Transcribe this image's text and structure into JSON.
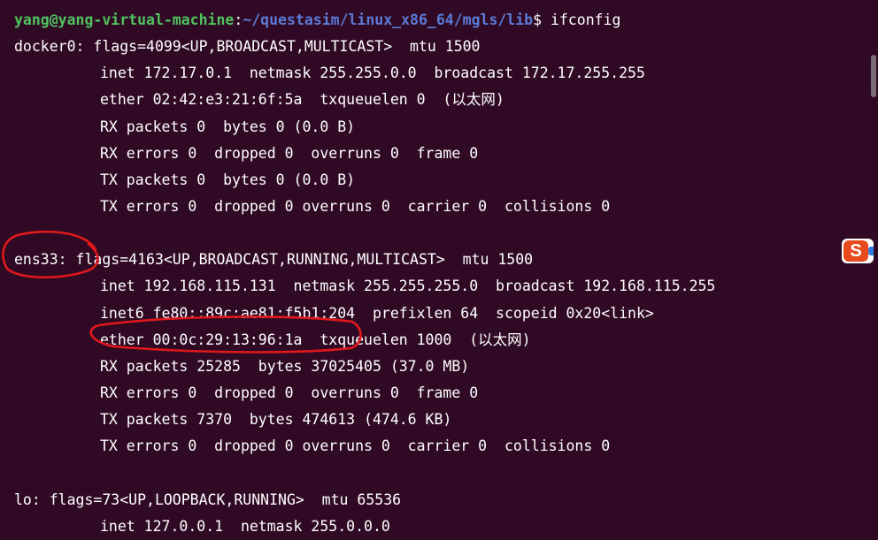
{
  "prompt": {
    "user_host": "yang@yang-virtual-machine",
    "path": "~/questasim/linux_x86_64/mgls/lib",
    "symbol": "$ ",
    "command": "ifconfig"
  },
  "lines": [
    "docker0: flags=4099<UP,BROADCAST,MULTICAST>  mtu 1500",
    "inet 172.17.0.1  netmask 255.255.0.0  broadcast 172.17.255.255",
    "ether 02:42:e3:21:6f:5a  txqueuelen 0  (以太网)",
    "RX packets 0  bytes 0 (0.0 B)",
    "RX errors 0  dropped 0  overruns 0  frame 0",
    "TX packets 0  bytes 0 (0.0 B)",
    "TX errors 0  dropped 0 overruns 0  carrier 0  collisions 0",
    "ens33: flags=4163<UP,BROADCAST,RUNNING,MULTICAST>  mtu 1500",
    "inet 192.168.115.131  netmask 255.255.255.0  broadcast 192.168.115.255",
    "inet6 fe80::89c:ae81:f5b1:204  prefixlen 64  scopeid 0x20<link>",
    "ether 00:0c:29:13:96:1a  txqueuelen 1000  (以太网)",
    "RX packets 25285  bytes 37025405 (37.0 MB)",
    "RX errors 0  dropped 0  overruns 0  frame 0",
    "TX packets 7370  bytes 474613 (474.6 KB)",
    "TX errors 0  dropped 0 overruns 0  carrier 0  collisions 0",
    "lo: flags=73<UP,LOOPBACK,RUNNING>  mtu 65536",
    "inet 127.0.0.1  netmask 255.0.0.0"
  ],
  "floating_icon": {
    "letter": "S",
    "name": "sogou-input-icon"
  },
  "colors": {
    "background": "#300a24",
    "user_host": "#4fc25f",
    "path": "#5c7ad6",
    "text": "#ffffff",
    "annotation": "#e0181b"
  }
}
